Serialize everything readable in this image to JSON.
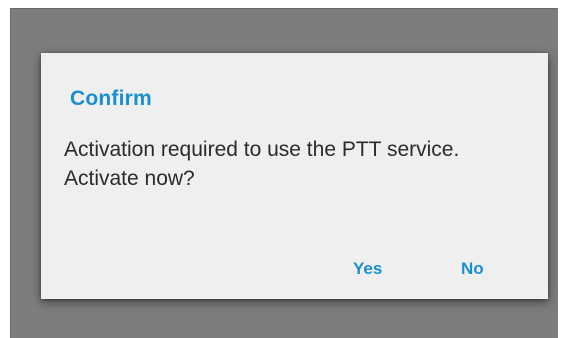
{
  "dialog": {
    "title": "Confirm",
    "message": "Activation required to use the PTT service. Activate now?",
    "actions": {
      "yes_label": "Yes",
      "no_label": "No"
    }
  },
  "colors": {
    "accent": "#1a8fcf",
    "scrim": "#7d7d7d",
    "dialog_background": "#efefef",
    "message_text": "#2b2b2b"
  }
}
